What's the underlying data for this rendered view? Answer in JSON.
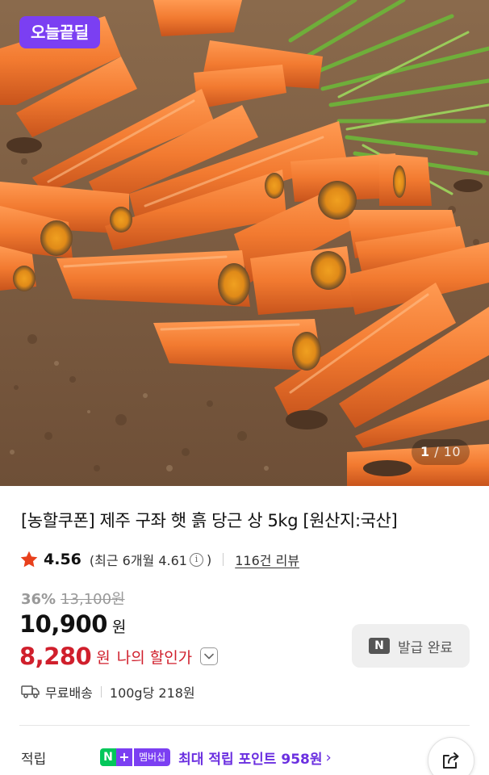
{
  "hero": {
    "badge": "오늘끝딜",
    "counter_current": "1",
    "counter_separator": "/",
    "counter_total": "10"
  },
  "product": {
    "title": "[농할쿠폰] 제주 구좌 햇 흙 당근 상 5kg [원산지:국산]"
  },
  "rating": {
    "value": "4.56",
    "recent_text": "(최근 6개월 4.61",
    "recent_close": ")",
    "info_icon": "i",
    "review_link": "116건 리뷰"
  },
  "price": {
    "discount_rate": "36%",
    "original_price": "13,100원",
    "sale_price": "10,900",
    "sale_unit": "원",
    "my_price": "8,280",
    "my_price_unit": "원",
    "my_price_label": "나의 할인가"
  },
  "coupon": {
    "icon_text": "N",
    "label": "발급 완료"
  },
  "shipping": {
    "free_label": "무료배송",
    "unit_price": "100g당 218원"
  },
  "points": {
    "label": "적립",
    "badge_n": "N",
    "badge_plus": "+",
    "badge_member": "멤버십",
    "text": "최대 적립 포인트 958원",
    "chevron": "›"
  },
  "colors": {
    "accent_purple": "#7b3ff2",
    "discount_red": "#d01f2c",
    "naver_green": "#03c75a"
  },
  "icons": [
    "star-icon",
    "info-icon",
    "chevron-down-icon",
    "n-icon",
    "truck-icon",
    "share-icon"
  ]
}
